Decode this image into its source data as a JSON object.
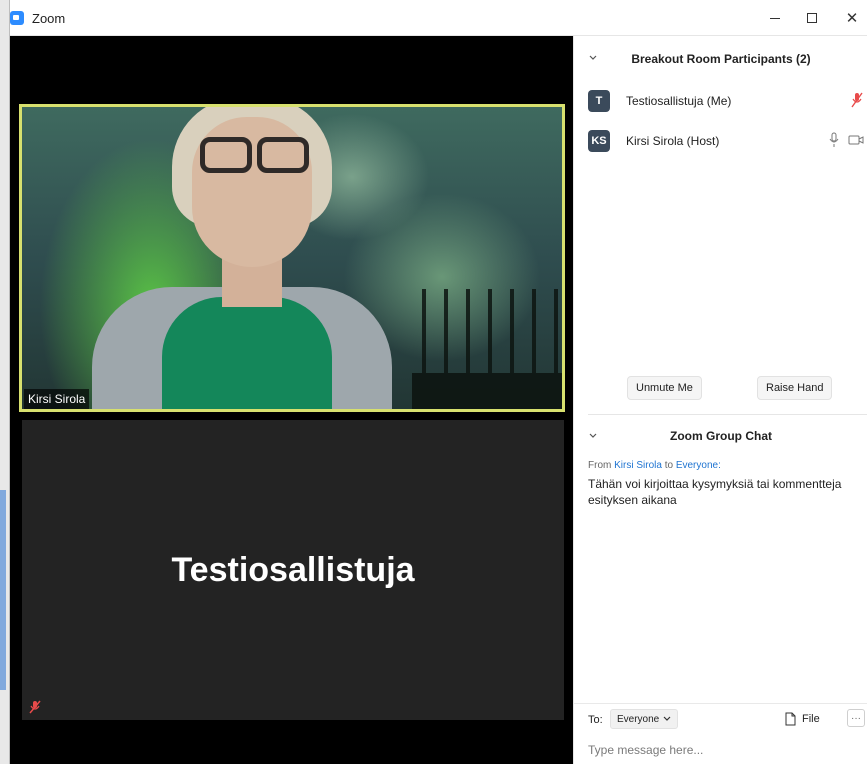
{
  "window": {
    "title": "Zoom",
    "minimize_icon": "minimize-icon",
    "maximize_icon": "maximize-icon",
    "close_icon": "close-icon"
  },
  "video": {
    "top_tile_name": "Kirsi Sirola",
    "bottom_tile_name": "Testiosallistuja",
    "top_tile_highlight_color": "#d7e06e"
  },
  "participants_panel": {
    "title": "Breakout Room Participants (2)",
    "participants": [
      {
        "initials": "T",
        "name": "Testiosallistuja (Me)",
        "mic": "muted"
      },
      {
        "initials": "KS",
        "name": "Kirsi Sirola (Host)",
        "mic": "on",
        "video": "on"
      }
    ],
    "unmute_label": "Unmute Me",
    "raise_hand_label": "Raise Hand"
  },
  "chat": {
    "title": "Zoom Group Chat",
    "meta_from": "From",
    "meta_sender": "Kirsi Sirola",
    "meta_to": "to",
    "meta_recipient": "Everyone:",
    "message": "Tähän voi kirjoittaa kysymyksiä tai kommentteja esityksen aikana",
    "to_label": "To:",
    "to_value": "Everyone",
    "file_label": "File",
    "more_label": "···",
    "placeholder": "Type message here..."
  }
}
